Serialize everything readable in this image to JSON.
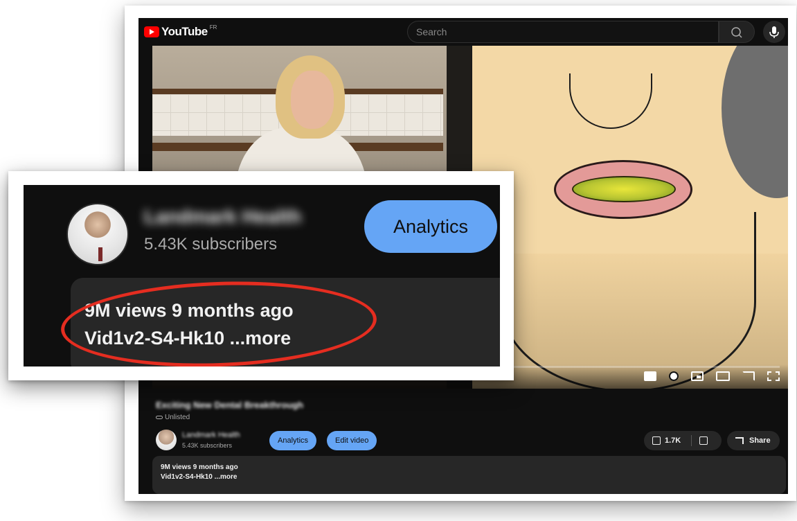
{
  "header": {
    "logo_text": "YouTube",
    "country_code": "FR",
    "search_placeholder": "Search"
  },
  "video": {
    "title": "Exciting New Dental Breakthrough",
    "visibility": "Unlisted"
  },
  "channel": {
    "name": "Landmark Health",
    "subscribers": "5.43K subscribers"
  },
  "buttons": {
    "analytics": "Analytics",
    "edit_video": "Edit video",
    "likes": "1.7K",
    "share": "Share"
  },
  "description": {
    "views_age": "9M views  9 months ago",
    "snippet_more": "Vid1v2-S4-Hk10 ...more"
  },
  "colors": {
    "accent_blue": "#65a5f5",
    "highlight_red": "#e52d20",
    "youtube_red": "#ff0000"
  }
}
